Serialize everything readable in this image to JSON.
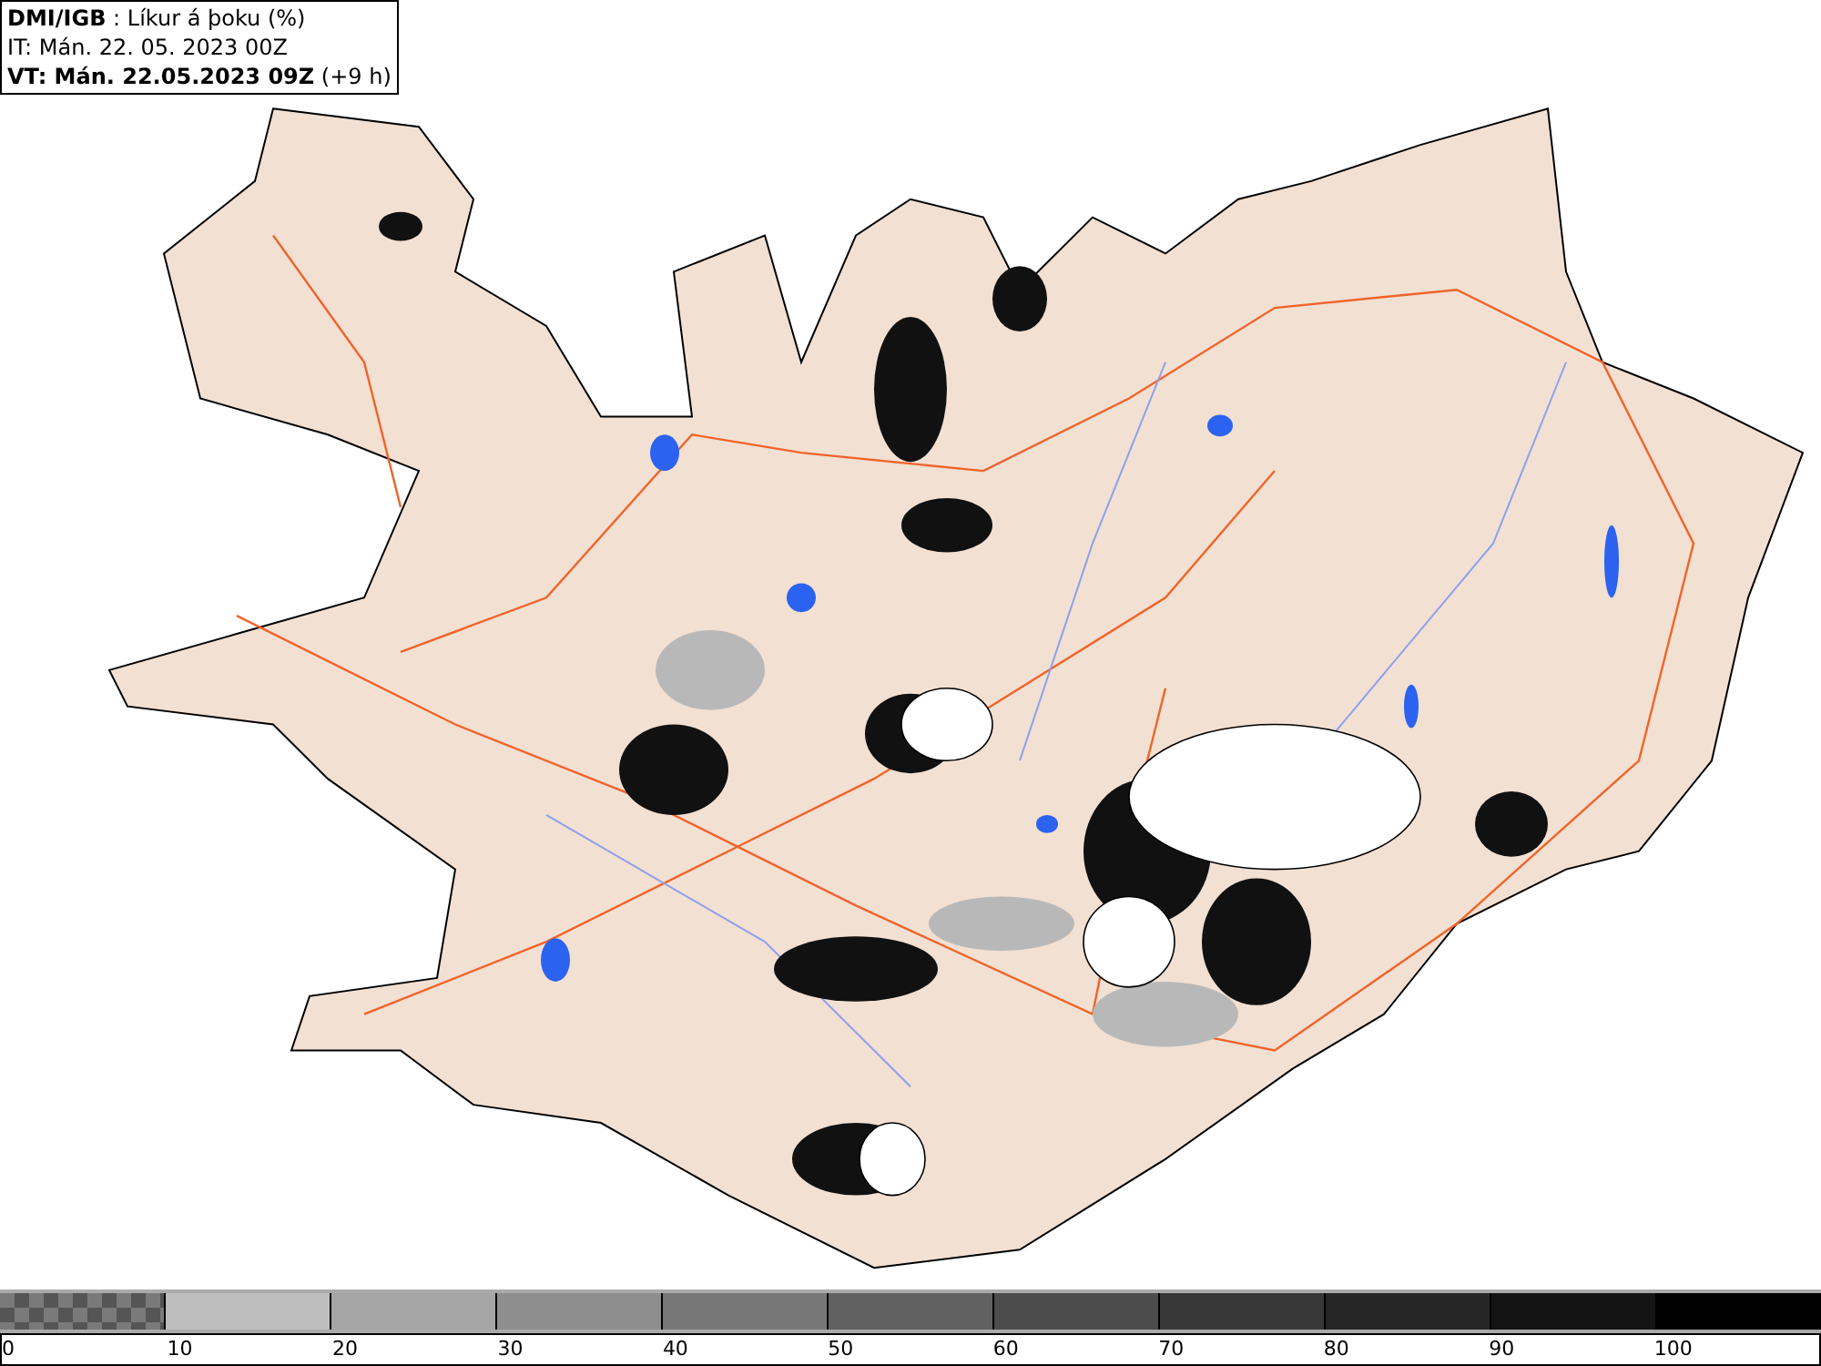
{
  "header": {
    "lines": [
      "**DMI/IGB** : Líkur á þoku (%)",
      "IT: Mán. 22. 05. 2023 00Z",
      "**VT: Mán. 22.05.2023 09Z** (+9 h)"
    ]
  },
  "colorbar": {
    "segments": [
      {
        "label": "0",
        "color": "#7a7a7a",
        "kind": "checkered"
      },
      {
        "label": "10",
        "color": "#bdbdbd",
        "kind": "solid"
      },
      {
        "label": "20",
        "color": "#a5a5a5",
        "kind": "solid"
      },
      {
        "label": "30",
        "color": "#8e8e8e",
        "kind": "solid"
      },
      {
        "label": "40",
        "color": "#777777",
        "kind": "solid"
      },
      {
        "label": "50",
        "color": "#616161",
        "kind": "solid"
      },
      {
        "label": "60",
        "color": "#4c4c4c",
        "kind": "solid"
      },
      {
        "label": "70",
        "color": "#383838",
        "kind": "solid"
      },
      {
        "label": "80",
        "color": "#262626",
        "kind": "solid"
      },
      {
        "label": "90",
        "color": "#141414",
        "kind": "solid"
      },
      {
        "label": "100",
        "color": "#000000",
        "kind": "solid"
      }
    ]
  }
}
